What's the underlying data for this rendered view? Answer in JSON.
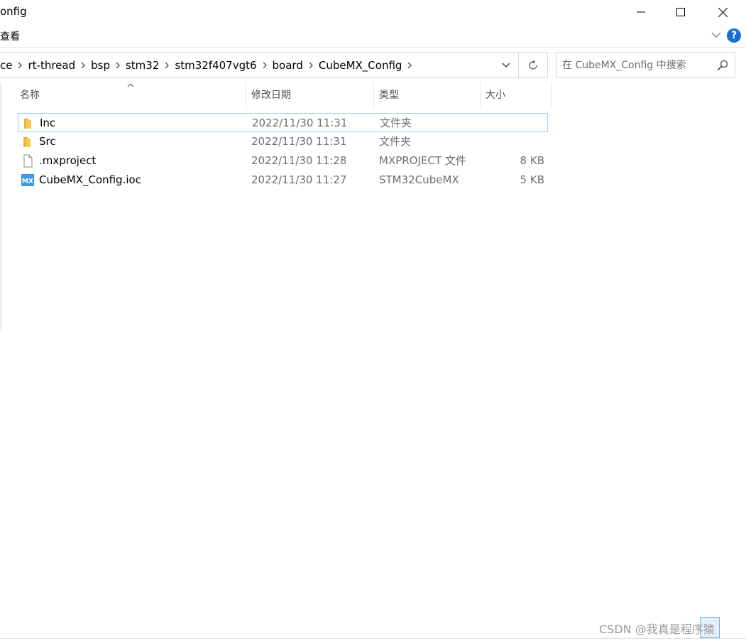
{
  "window": {
    "title": "onfig",
    "ribbon_tab": "查看"
  },
  "address": {
    "crumbs": [
      "ce",
      "rt-thread",
      "bsp",
      "stm32",
      "stm32f407vgt6",
      "board",
      "CubeMX_Config"
    ]
  },
  "search": {
    "placeholder": "在 CubeMX_Config 中搜索"
  },
  "columns": {
    "name": "名称",
    "date": "修改日期",
    "type": "类型",
    "size": "大小"
  },
  "files": [
    {
      "name": "Inc",
      "date": "2022/11/30 11:31",
      "type": "文件夹",
      "size": "",
      "icon": "folder-icon"
    },
    {
      "name": "Src",
      "date": "2022/11/30 11:31",
      "type": "文件夹",
      "size": "",
      "icon": "folder-icon"
    },
    {
      "name": ".mxproject",
      "date": "2022/11/30 11:28",
      "type": "MXPROJECT 文件",
      "size": "8 KB",
      "icon": "file-icon"
    },
    {
      "name": "CubeMX_Config.ioc",
      "date": "2022/11/30 11:27",
      "type": "STM32CubeMX",
      "size": "5 KB",
      "icon": "cubemx-icon"
    }
  ],
  "cubemx_icon_text": "MX",
  "help_glyph": "?",
  "watermark": "CSDN @我真是程序猿",
  "colors": {
    "selection_border": "#99d1ff",
    "folder": "#f3c94f",
    "cubemx": "#3b9ad9",
    "help": "#1a6fd1"
  }
}
